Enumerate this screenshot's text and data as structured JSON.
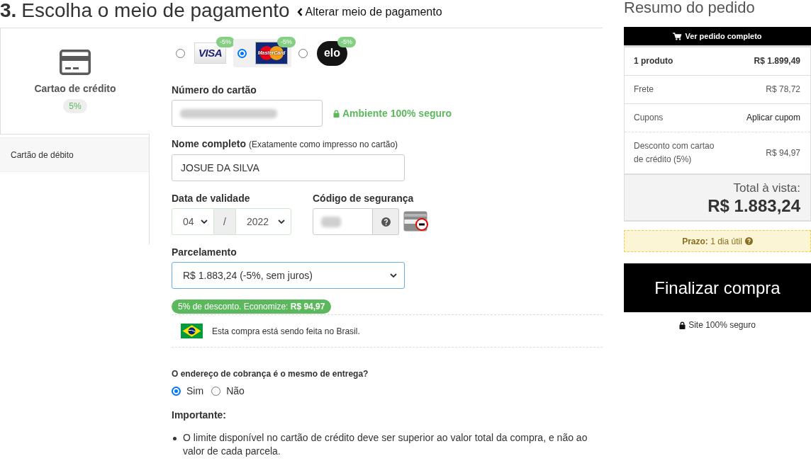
{
  "heading": {
    "step": "3.",
    "title": "Escolha o meio de pagamento"
  },
  "change_link": {
    "label": "Alterar meio de pagamento"
  },
  "payment_methods": [
    {
      "label": "Cartao de crédito",
      "badge": "5%",
      "selected": true
    },
    {
      "label": "Cartão de débito",
      "selected": false
    }
  ],
  "card_brands": [
    {
      "kind": "visa",
      "logo_text": "VISA",
      "badge": "-5%",
      "selected": false
    },
    {
      "kind": "mastercard",
      "logo_text": "MasterCard",
      "badge": "-5%",
      "selected": true
    },
    {
      "kind": "elo",
      "logo_text": "elo",
      "badge": "-5%",
      "selected": false
    }
  ],
  "card_number": {
    "label": "Número do cartão"
  },
  "security_note": "Ambiente 100% seguro",
  "full_name": {
    "label": "Nome completo",
    "hint": "(Exatamente como impresso no cartão)",
    "value": "JOSUE DA SILVA"
  },
  "expiry": {
    "label": "Data de validade",
    "month": "04",
    "separator": "/",
    "year": "2022"
  },
  "security_code": {
    "label": "Código de segurança"
  },
  "installments": {
    "label": "Parcelamento",
    "value": "R$ 1.883,24 (-5%, sem juros)"
  },
  "discount_note": "5% de desconto. Economize: **R$ 94,97**",
  "country_note": "Esta compra está sendo feita no Brasil.",
  "billing_address": {
    "question": "O endereço de cobrança é o mesmo de entrega?",
    "options": [
      {
        "label": "Sim",
        "selected": true
      },
      {
        "label": "Não",
        "selected": false
      }
    ]
  },
  "important": {
    "title": "Importante:",
    "items": [
      "O limite disponível no cartão de crédito deve ser superior ao valor total da compra, e não ao valor de cada parcela."
    ]
  },
  "summary": {
    "title": "Resumo do pedido",
    "view_order": "Ver pedido completo",
    "rows": [
      {
        "kind": "strong",
        "label": "1 produto",
        "value": "R$ 1.899,49"
      },
      {
        "kind": "plain",
        "label": "Frete",
        "value": "R$ 78,72"
      },
      {
        "kind": "action",
        "label": "Cupons",
        "value": "Aplicar cupom"
      },
      {
        "kind": "plain",
        "label": "Desconto com cartao de crédito (5%)",
        "value": "R$ 94,97"
      }
    ],
    "total_label": "Total à vista:",
    "total": "R$ 1.883,24",
    "deadline": "**Prazo:** 1 dia útil",
    "checkout": "Finalizar compra",
    "secure_note": "Site 100% seguro"
  }
}
